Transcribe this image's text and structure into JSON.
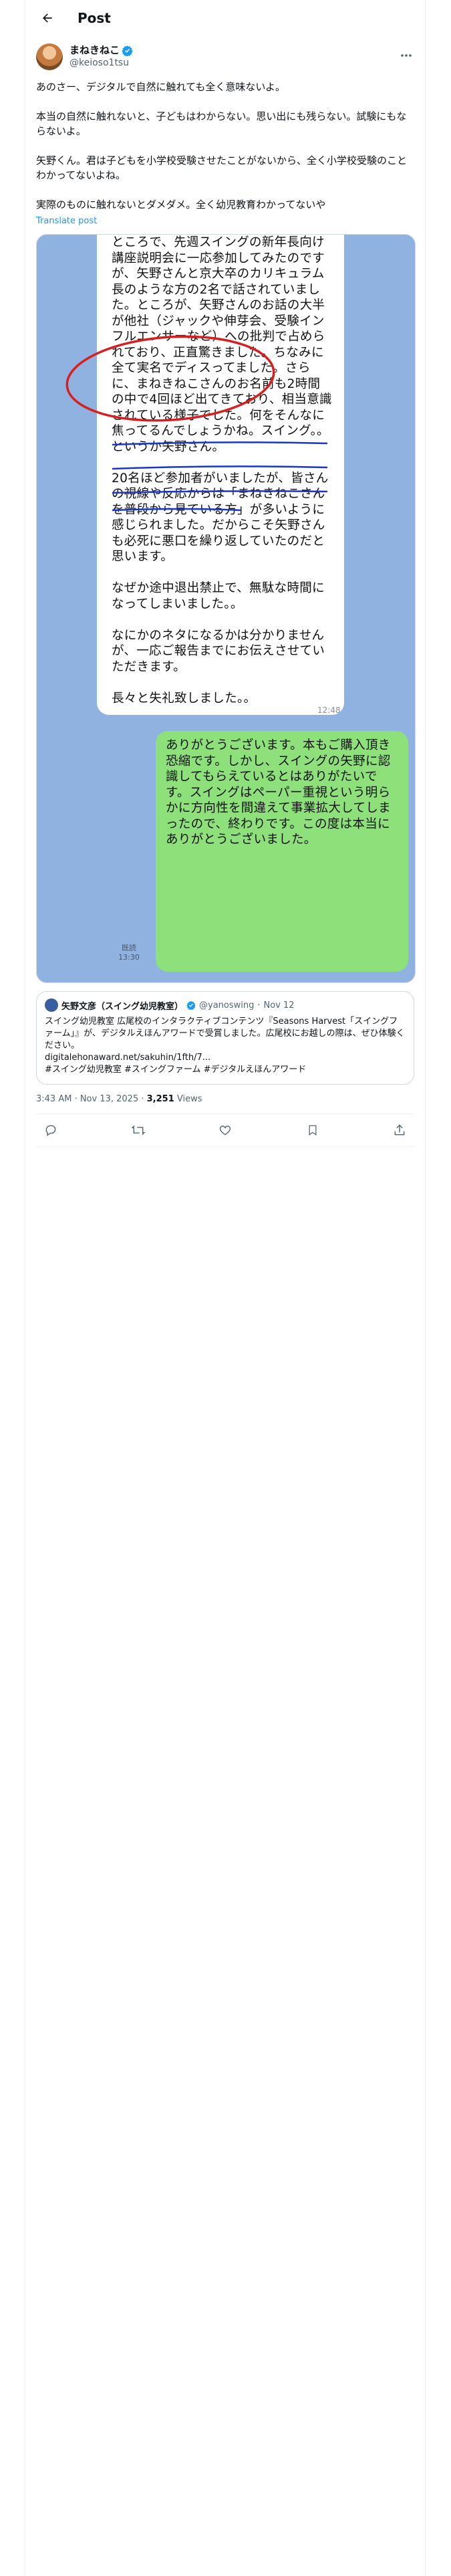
{
  "header": {
    "title": "Post"
  },
  "post": {
    "author": {
      "name": "まねきねこ",
      "handle": "@keioso1tsu"
    },
    "text": "あのさー、デジタルで自然に触れても全く意味ないよ。\n\n本当の自然に触れないと、子どもはわからない。思い出にも残らない。試験にもならないよ。\n\n矢野くん。君は子どもを小学校受験させたことがないから、全く小学校受験のことわかってないよね。\n\n実際のものに触れないとダメダメ。全く幼児教育わかってないや",
    "translate_label": "Translate post",
    "image": {
      "white_bubble_text": "ところで、先週スイングの新年長向け講座説明会に一応参加してみたのですが、矢野さんと京大卒のカリキュラム長のような方の2名で話されていました。ところが、矢野さんのお話の大半が他社（ジャックや伸芽会、受験インフルエンサーなど）への批判で占められており、正直驚きました。ちなみに全て実名でディスってました。さらに、まねきねこさんのお名前も2時間の中で4回ほど出てきており、相当意識されている様子でした。何をそんなに焦ってるんでしょうかね。スイング。。というか矢野さん。\n\n20名ほど参加者がいましたが、皆さんの視線や反応からは「まねきねこさんを普段から見ている方」が多いように感じられました。だからこそ矢野さんも必死に悪口を繰り返していたのだと思います。\n\nなぜか途中退出禁止で、無駄な時間になってしまいました。。\n\nなにかのネタになるかは分かりませんが、一応ご報告までにお伝えさせていただきます。\n\n長々と失礼致しました。。",
      "white_bubble_time": "12:48",
      "green_bubble_text": "ありがとうございます。本もご購入頂き恐縮です。しかし、スイングの矢野に認識してもらえているとはありがたいです。スイングはペーパー重視という明らかに方向性を間違えて事業拡大してしまったので、終わりです。この度は本当にありがとうございました。",
      "read_stamp": "既読\n13:30"
    },
    "quote": {
      "name": "矢野文彦（スイング幼児教室）",
      "handle": "@yanoswing",
      "date": "Nov 12",
      "text": "スイング幼児教室 広尾校のインタラクティブコンテンツ『Seasons Harvest「スイングファーム」』が、デジタルえほんアワードで受賞しました。広尾校にお越しの際は、ぜひ体験ください。\ndigitalehonaward.net/sakuhin/1fth/7...\n#スイング幼児教室 #スイングファーム #デジタルえほんアワード"
    },
    "timestamp": "3:43 AM · Nov 13, 2025 · ",
    "views_count": "3,251",
    "views_label": " Views"
  },
  "colors": {
    "accent": "#1d9bf0",
    "verified": "#1d9bf0",
    "line_green": "#8de07a",
    "chat_bg": "#8fb2e0",
    "annotation_red": "#d62020",
    "annotation_blue": "#1b36c9"
  },
  "icons": [
    "back-arrow-icon",
    "verified-badge-icon",
    "more-icon",
    "reply-icon",
    "repost-icon",
    "like-icon",
    "bookmark-icon",
    "share-icon"
  ]
}
